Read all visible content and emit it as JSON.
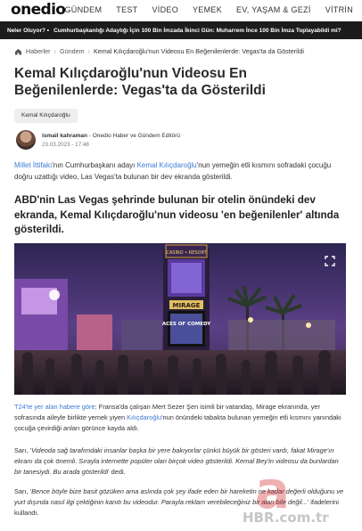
{
  "nav": {
    "logo": "onedio",
    "links": [
      "GÜNDEM",
      "TEST",
      "VİDEO",
      "YEMEK",
      "EV, YAŞAM & GEZİ",
      "VİTRİN"
    ]
  },
  "ticker": {
    "label": "Neler Oluyor? •",
    "text": "Cumhurbaşkanlığı Adaylığı İçin 100 Bin İmzada İkinci Gün: Muharrem İnce 100 Bin İmza Toplayabildi mi?"
  },
  "breadcrumb": {
    "items": [
      "Haberler",
      "Gündem",
      "Kemal Kılıçdaroğlu'nun Videosu En Beğenilenlerde: Vegas'ta da Gösterildi"
    ]
  },
  "article": {
    "title": "Kemal Kılıçdaroğlu'nun Videosu En Beğenilenlerde: Vegas'ta da Gösterildi",
    "tag": "Kemal Kılıçdaroğlu",
    "author_name": "ismail kahraman",
    "author_role": " - Onedio Haber ve Gündem Editörü",
    "date": "23.03.2023 - 17:48",
    "p1": {
      "link1": "Millet İttifakı",
      "t1": "'nın Cumhurbaşkanı adayı ",
      "link2": "Kemal Kılıçdaroğlu",
      "t2": "'nun yemeğin etli kısmını sofradaki çocuğu doğru uzattığı video, Las Vegas'ta bulunan bir dev ekranda gösterildi."
    },
    "lead": "ABD'nin Las Vegas şehrinde bulunan bir otelin önündeki dev ekranda, Kemal Kılıçdaroğlu'nun videosu 'en beğenilenler' altında gösterildi.",
    "p2": {
      "link1": "T24'te yer alan habere göre;",
      "t1": " Fransa'da çalışan Mert Sezer Şen isimli bir vatandaş, Mirage ekranında, yer sofrasında aileyle birlikte yemek yiyen ",
      "link2": "Kılıçdaroğlu",
      "t2": "'nun önündeki tabakta bulunan yemeğin etli kısmını yanındaki çocuğa çevirdiği anları görünce kayda aldı."
    },
    "p3": {
      "t1": "Sarı, '",
      "quote": "Videoda sağ tarafımdaki insanlar başka bir yere bakıyorlar çünkü büyük bir gösteri vardı, fakat Mirage'ın ekranı da çok önemli. Sırayla internette popüler olan birçok video gösterildi. Kemal Bey'in videosu da bunlardan bir tanesiydi. Bu arada gösterildi",
      "t2": "' dedi."
    },
    "p4": {
      "t1": "Sarı, '",
      "quote": "Bence böyle bize basit gözüken ama aslında çok şey ifade eden bir hareketin ne kadar değerli olduğunu ve yurt dışında nasıl ilgi çektiğinin kanıtı bu videodur. Parayla reklam verebileceğiniz bir alan bile değil...",
      "t2": "' ifadelerini kullandı."
    }
  },
  "video": {
    "sign_top": "CASINO • RESORT",
    "sign_name": "MIRAGE",
    "screen_text": "ACES OF COMEDY"
  },
  "watermark": {
    "text": "HBR.com.tr"
  },
  "colors": {
    "link": "#3a7bd5",
    "ticker_bg": "#1c1c1c"
  }
}
